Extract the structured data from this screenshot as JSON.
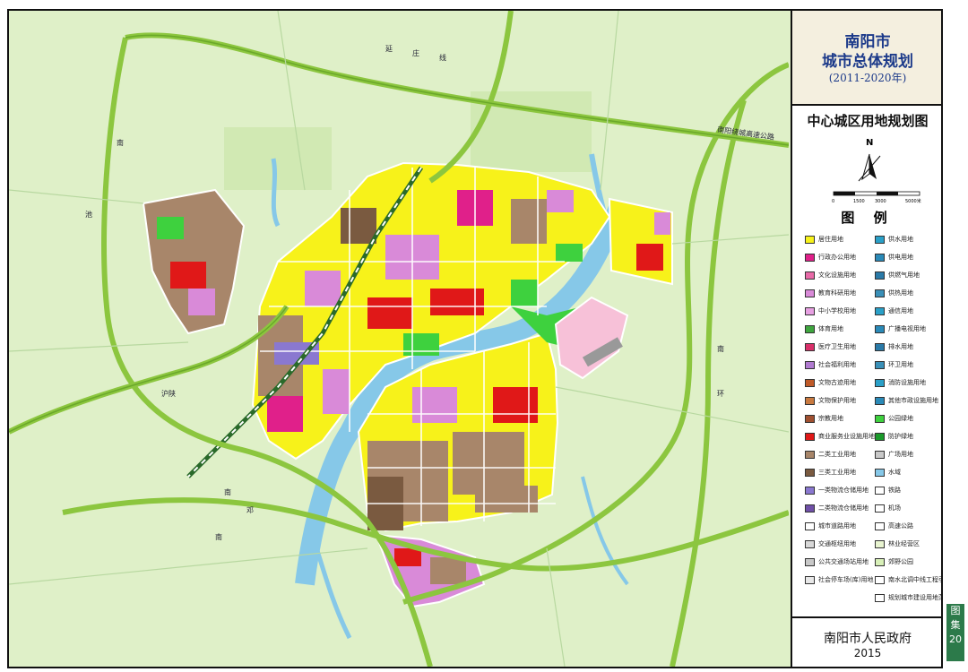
{
  "title": {
    "city": "南阳市",
    "plan": "城市总体规划",
    "period": "(2011-2020年)"
  },
  "subtitle": "中心城区用地规划图",
  "north_label": "N",
  "scale_ticks": [
    "0",
    "1500",
    "3000",
    "5000米"
  ],
  "legend_title": "图 例",
  "legend_left": [
    {
      "label": "居住用地",
      "color": "#f7f21a"
    },
    {
      "label": "行政办公用地",
      "color": "#e0208a"
    },
    {
      "label": "文化设施用地",
      "color": "#e86aa8"
    },
    {
      "label": "教育科研用地",
      "color": "#d98ad8"
    },
    {
      "label": "中小学校用地",
      "color": "#e7a0e2"
    },
    {
      "label": "体育用地",
      "color": "#3fa63f"
    },
    {
      "label": "医疗卫生用地",
      "color": "#d9306a"
    },
    {
      "label": "社会福利用地",
      "color": "#b07ad0"
    },
    {
      "label": "文物古迹用地",
      "color": "#c05a28"
    },
    {
      "label": "文物保护用地",
      "color": "#c97a40"
    },
    {
      "label": "宗教用地",
      "color": "#a05030"
    },
    {
      "label": "商业服务业设施用地",
      "color": "#e01818"
    },
    {
      "label": "二类工业用地",
      "color": "#a8866a"
    },
    {
      "label": "三类工业用地",
      "color": "#7a5a40"
    },
    {
      "label": "一类物流仓储用地",
      "color": "#8a78d0"
    },
    {
      "label": "二类物流仓储用地",
      "color": "#7050a8"
    },
    {
      "label": "城市道路用地",
      "color": "#ffffff"
    },
    {
      "label": "交通枢纽用地",
      "color": "#d8d8d8"
    },
    {
      "label": "公共交通场站用地",
      "color": "#c8c8c8"
    },
    {
      "label": "社会停车场(库)用地",
      "color": "#e8e8e8"
    }
  ],
  "legend_right": [
    {
      "label": "供水用地",
      "color": "#2aa0c8"
    },
    {
      "label": "供电用地",
      "color": "#2a8ab8"
    },
    {
      "label": "供燃气用地",
      "color": "#2a7aa8"
    },
    {
      "label": "供热用地",
      "color": "#3a90b8"
    },
    {
      "label": "通信用地",
      "color": "#2aa0c8"
    },
    {
      "label": "广播电视用地",
      "color": "#2a8ab8"
    },
    {
      "label": "排水用地",
      "color": "#2a7aa8"
    },
    {
      "label": "环卫用地",
      "color": "#3a90b8"
    },
    {
      "label": "消防设施用地",
      "color": "#2aa0c8"
    },
    {
      "label": "其他市政设施用地",
      "color": "#2a8ab8"
    },
    {
      "label": "公园绿地",
      "color": "#3ed13e"
    },
    {
      "label": "防护绿地",
      "color": "#1a9a2a"
    },
    {
      "label": "广场用地",
      "color": "#c8c8c8"
    },
    {
      "label": "水域",
      "color": "#86c8e8"
    },
    {
      "label": "铁路",
      "color": "#ffffff"
    },
    {
      "label": "机场",
      "color": "#ffffff"
    },
    {
      "label": "高速公路",
      "color": "#ffffff"
    },
    {
      "label": "林业经营区",
      "color": "#e8f4d0"
    },
    {
      "label": "郊野公园",
      "color": "#d8f0b8"
    },
    {
      "label": "南水北调中线工程引水渠",
      "color": "#ffffff"
    },
    {
      "label": "规划城市建设用地范围",
      "color": "#ffffff"
    }
  ],
  "government": "南阳市人民政府",
  "year": "2015",
  "tab_chars": [
    "图",
    "集",
    "20"
  ],
  "map_labels": {
    "ring_nw": "南",
    "ring_w": "池",
    "ring_sw": "南",
    "east_road": "南",
    "east_road2": "环",
    "north_road": "延",
    "north_road2": "庄",
    "north_road3": "线",
    "expressway_ne": "南阳绕城高速公路",
    "west_road": "沪陕",
    "south_road": "南",
    "south_road2": "邓"
  },
  "colors": {
    "residential": "#f7f21a",
    "commercial": "#e01818",
    "industry": "#a8866a",
    "industry_dark": "#7a5a40",
    "education": "#d98ad8",
    "admin": "#e0208a",
    "green": "#3ed13e",
    "water": "#86c8e8",
    "ring_road": "#8cc63f",
    "background": "#dff0c8"
  }
}
